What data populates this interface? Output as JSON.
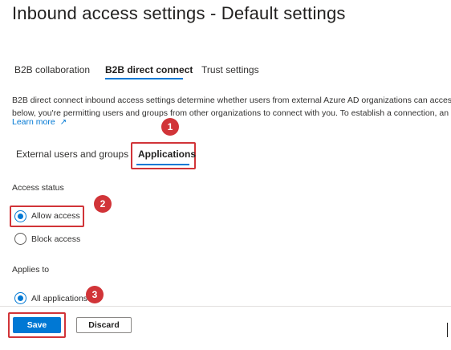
{
  "page": {
    "title": "Inbound access settings - Default settings",
    "more_label": "···"
  },
  "tabs": [
    {
      "label": "B2B collaboration",
      "active": false
    },
    {
      "label": "B2B direct connect",
      "active": true
    },
    {
      "label": "Trust settings",
      "active": false
    }
  ],
  "description": {
    "line1": "B2B direct connect inbound access settings determine whether users from external Azure AD organizations can access",
    "line2": "below, you're permitting users and groups from other organizations to connect with you. To establish a connection, an",
    "learn_more": "Learn more",
    "learn_more_icon": "↗"
  },
  "subtabs": [
    {
      "label": "External users and groups",
      "active": false
    },
    {
      "label": "Applications",
      "active": true
    }
  ],
  "access_status": {
    "label": "Access status",
    "options": [
      {
        "label": "Allow access",
        "checked": true
      },
      {
        "label": "Block access",
        "checked": false
      }
    ]
  },
  "applies_to": {
    "label": "Applies to",
    "options": [
      {
        "label": "All applications",
        "checked": true
      }
    ]
  },
  "annotations": [
    "1",
    "2",
    "3"
  ],
  "footer": {
    "save_label": "Save",
    "discard_label": "Discard"
  },
  "colors": {
    "accent": "#0078d4",
    "highlight": "#d13438"
  }
}
